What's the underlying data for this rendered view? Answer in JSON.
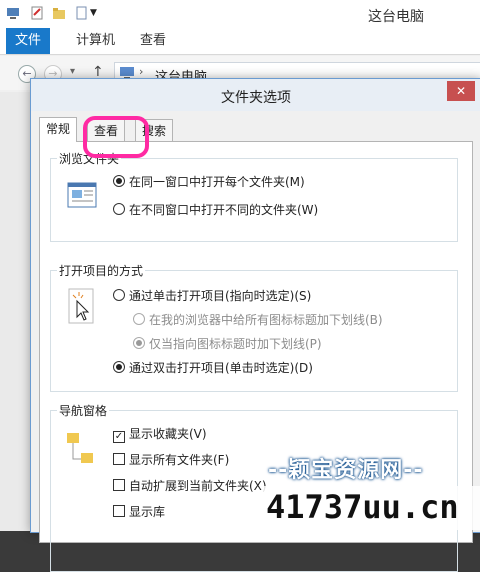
{
  "window": {
    "title": "这台电脑"
  },
  "ribbon": {
    "tabs": [
      "文件",
      "计算机",
      "查看"
    ]
  },
  "address": {
    "path": "这台电脑",
    "back": "←",
    "forward": "→",
    "up": "↑"
  },
  "dialog": {
    "title": "文件夹选项",
    "close": "✕",
    "tabs": [
      "常规",
      "查看",
      "搜索"
    ],
    "groups": {
      "browse": {
        "label": "浏览文件夹",
        "options": [
          {
            "label": "在同一窗口中打开每个文件夹(M)",
            "selected": true
          },
          {
            "label": "在不同窗口中打开不同的文件夹(W)",
            "selected": false
          }
        ]
      },
      "open": {
        "label": "打开项目的方式",
        "options": [
          {
            "label": "通过单击打开项目(指向时选定)(S)",
            "selected": false
          },
          {
            "label": "在我的浏览器中给所有图标标题加下划线(B)",
            "selected": false,
            "disabled": true
          },
          {
            "label": "仅当指向图标标题时加下划线(P)",
            "selected": true,
            "disabled": true
          },
          {
            "label": "通过双击打开项目(单击时选定)(D)",
            "selected": true
          }
        ]
      },
      "nav": {
        "label": "导航窗格",
        "options": [
          {
            "label": "显示收藏夹(V)",
            "checked": true
          },
          {
            "label": "显示所有文件夹(F)",
            "checked": false
          },
          {
            "label": "自动扩展到当前文件夹(X)",
            "checked": false
          },
          {
            "label": "显示库",
            "checked": false
          }
        ]
      }
    }
  },
  "watermark": {
    "line1": "--颖宝资源网--",
    "url": "41737uu.cn"
  },
  "colors": {
    "accent": "#1979ca",
    "highlight": "#ff2aa3",
    "close": "#c75050"
  }
}
